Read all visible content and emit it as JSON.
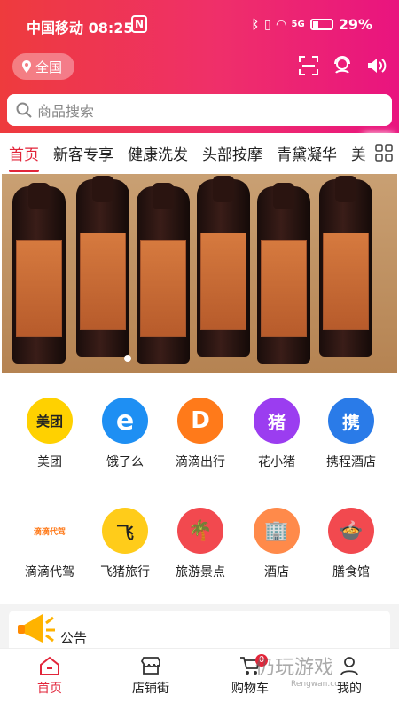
{
  "status": {
    "carrier_time": "中国移动 08:25",
    "nfc": "N",
    "battery": "29%",
    "signal": "5G"
  },
  "header": {
    "location": "全国",
    "search_placeholder": "商品搜索"
  },
  "tabs": [
    {
      "label": "首页",
      "active": true
    },
    {
      "label": "新客专享",
      "active": false
    },
    {
      "label": "健康洗发",
      "active": false
    },
    {
      "label": "头部按摩",
      "active": false
    },
    {
      "label": "青黛凝华",
      "active": false
    },
    {
      "label": "美",
      "active": false
    }
  ],
  "services_row1": [
    {
      "label": "美团",
      "icon": "meituan-icon",
      "color": "#ffd100",
      "text": "美团"
    },
    {
      "label": "饿了么",
      "icon": "eleme-icon",
      "color": "#1e8ff3",
      "text": "e"
    },
    {
      "label": "滴滴出行",
      "icon": "didi-icon",
      "color": "#ff7a1a",
      "text": "D"
    },
    {
      "label": "花小猪",
      "icon": "huaxiaozhu-icon",
      "color": "#9b3df0",
      "text": "猪"
    },
    {
      "label": "携程酒店",
      "icon": "ctrip-icon",
      "color": "#2a7be8",
      "text": "携"
    }
  ],
  "services_row2": [
    {
      "label": "滴滴代驾",
      "icon": "didi-daijia-icon",
      "color": "#ffffff",
      "text": "滴滴代驾"
    },
    {
      "label": "飞猪旅行",
      "icon": "fliggy-icon",
      "color": "#ffcc1a",
      "text": "飞"
    },
    {
      "label": "旅游景点",
      "icon": "palm-tree-icon",
      "color": "#f2494f",
      "text": "🌴"
    },
    {
      "label": "酒店",
      "icon": "hotel-icon",
      "color": "#ff8a4a",
      "text": "🏢"
    },
    {
      "label": "膳食馆",
      "icon": "food-bowl-icon",
      "color": "#f2494f",
      "text": "🍲"
    }
  ],
  "notice": {
    "title": "公告"
  },
  "tabbar": [
    {
      "label": "首页",
      "active": true
    },
    {
      "label": "店铺街",
      "active": false
    },
    {
      "label": "购物车",
      "active": false,
      "badge": "0"
    },
    {
      "label": "我的",
      "active": false
    }
  ],
  "watermark": {
    "title": "仍玩游戏",
    "sub": "Rengwan.com"
  },
  "colors": {
    "brand_red": "#e2253a",
    "header_start": "#ee3b3d",
    "header_end": "#e9147f"
  }
}
